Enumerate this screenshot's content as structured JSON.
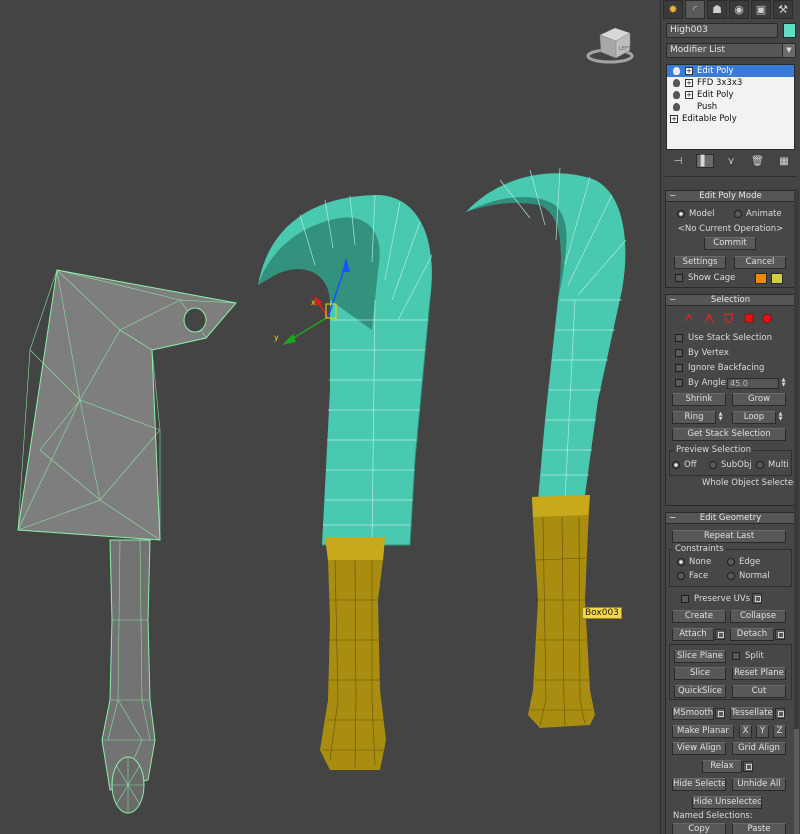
{
  "command_panel": {
    "tabs": [
      "create-tab",
      "modify-tab",
      "hierarchy-tab",
      "motion-tab",
      "display-tab",
      "utilities-tab"
    ],
    "object_name": "High003",
    "object_color": "#5fe0c4",
    "modifier_list": "Modifier List",
    "stack": [
      {
        "label": "Edit Poly",
        "selected": true
      },
      {
        "label": "FFD 3x3x3",
        "selected": false
      },
      {
        "label": "Edit Poly",
        "selected": false
      },
      {
        "label": "Push",
        "selected": false
      },
      {
        "label": "Editable Poly",
        "selected": false
      }
    ]
  },
  "edit_poly_mode": {
    "title": "Edit Poly Mode",
    "model": "Model",
    "animate": "Animate",
    "current_op": "<No Current Operation>",
    "commit": "Commit",
    "settings": "Settings",
    "cancel": "Cancel",
    "show_cage": "Show Cage",
    "cage_colors": [
      "#f08a00",
      "#d2cf40"
    ]
  },
  "selection": {
    "title": "Selection",
    "use_stack": "Use Stack Selection",
    "by_vertex": "By Vertex",
    "ignore_backfacing": "Ignore Backfacing",
    "by_angle": "By Angle:",
    "angle_value": "45.0",
    "shrink": "Shrink",
    "grow": "Grow",
    "ring": "Ring",
    "loop": "Loop",
    "get_stack": "Get Stack Selection",
    "preview": "Preview Selection",
    "off": "Off",
    "subobj": "SubObj",
    "multi": "Multi",
    "status": "Whole Object Selected"
  },
  "edit_geometry": {
    "title": "Edit Geometry",
    "repeat_last": "Repeat Last",
    "constraints": "Constraints",
    "none": "None",
    "edge": "Edge",
    "face": "Face",
    "normal": "Normal",
    "preserve_uvs": "Preserve UVs",
    "create": "Create",
    "collapse": "Collapse",
    "attach": "Attach",
    "detach": "Detach",
    "slice_plane": "Slice Plane",
    "split": "Split",
    "slice": "Slice",
    "reset_plane": "Reset Plane",
    "quickslice": "QuickSlice",
    "cut": "Cut",
    "msmooth": "MSmooth",
    "tessellate": "Tessellate",
    "make_planar": "Make Planar",
    "x": "X",
    "y": "Y",
    "z": "Z",
    "view_align": "View Align",
    "grid_align": "Grid Align",
    "relax": "Relax",
    "hide_selected": "Hide Selected",
    "unhide_all": "Unhide All",
    "hide_unselected": "Hide Unselected",
    "named_selections": "Named Selections:",
    "copy": "Copy",
    "paste": "Paste"
  },
  "viewport": {
    "tooltip": "Box003",
    "gizmo_axis_y": "y",
    "gizmo_axis_x": "x",
    "viewcube_label": "LEFT"
  }
}
